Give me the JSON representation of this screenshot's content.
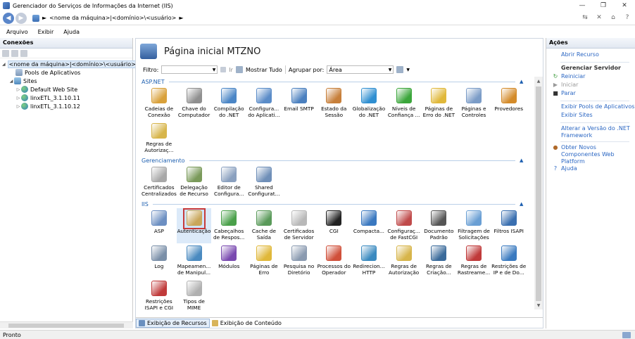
{
  "window": {
    "title": "Gerenciador do Serviços de Informações da Internet (IIS)",
    "controls": [
      "—",
      "❐",
      "✕"
    ]
  },
  "address": {
    "path": "<nome da máquina>|<domínio>\\<usuário>",
    "separator": "►"
  },
  "menu": {
    "items": [
      "Arquivo",
      "Exibir",
      "Ajuda"
    ]
  },
  "connections": {
    "header": "Conexões",
    "tree": [
      {
        "label": "<nome da máquina>|<domínio>\\<usuário>",
        "level": 0,
        "expander": "◢",
        "icon": "server-icon",
        "selected": true
      },
      {
        "label": "Pools de Aplicativos",
        "level": 1,
        "expander": "",
        "icon": "app-pool-icon"
      },
      {
        "label": "Sites",
        "level": 1,
        "expander": "◢",
        "icon": "sites-icon"
      },
      {
        "label": "Default Web Site",
        "level": 2,
        "expander": "▷",
        "icon": "globe-icon"
      },
      {
        "label": "linxETL_3.1.10.11",
        "level": 2,
        "expander": "▷",
        "icon": "globe-icon"
      },
      {
        "label": "linxETL_3.1.10.12",
        "level": 2,
        "expander": "▷",
        "icon": "globe-icon"
      }
    ]
  },
  "home": {
    "title": "Página inicial MTZNO",
    "filter_label": "Filtro:",
    "go_label": "Ir",
    "show_all_label": "Mostrar Tudo",
    "group_label": "Agrupar por:",
    "group_value": "Área"
  },
  "sections": [
    {
      "title": "ASP.NET",
      "items": [
        {
          "label": "Cadeias de Conexão",
          "color": "#d9a13b"
        },
        {
          "label": "Chave do Computador",
          "color": "#8f8f8f"
        },
        {
          "label": "Compilação do .NET",
          "color": "#4b86c6"
        },
        {
          "label": "Configura... do Aplicati...",
          "color": "#5a8cc8"
        },
        {
          "label": "Email SMTP",
          "color": "#4b80bf"
        },
        {
          "label": "Estado da Sessão",
          "color": "#c77f3a"
        },
        {
          "label": "Globalização do .NET",
          "color": "#2f8fd1"
        },
        {
          "label": "Níveis de Confiança ...",
          "color": "#3ba63b"
        },
        {
          "label": "Páginas de Erro do .NET",
          "color": "#e0b83a"
        },
        {
          "label": "Páginas e Controles",
          "color": "#7b9cc7"
        },
        {
          "label": "Provedores",
          "color": "#d48b2a"
        },
        {
          "label": "Regras de Autorizaç...",
          "color": "#d7b54a"
        }
      ]
    },
    {
      "title": "Gerenciamento",
      "items": [
        {
          "label": "Certificados Centralizados",
          "color": "#a8a8a8"
        },
        {
          "label": "Delegação de Recurso",
          "color": "#7a9a5a"
        },
        {
          "label": "Editor de Configura...",
          "color": "#8aa0bf"
        },
        {
          "label": "Shared Configurat...",
          "color": "#6f8fb8"
        }
      ]
    },
    {
      "title": "IIS",
      "items": [
        {
          "label": "ASP",
          "color": "#6c8fc2"
        },
        {
          "label": "Autenticação",
          "color": "#c9a65a",
          "selected": true
        },
        {
          "label": "Cabeçalhos de Respos...",
          "color": "#4aa04a"
        },
        {
          "label": "Cache de Saída",
          "color": "#5a9a5a"
        },
        {
          "label": "Certificados de Servidor",
          "color": "#b8b8b8"
        },
        {
          "label": "CGI",
          "color": "#222222"
        },
        {
          "label": "Compacta...",
          "color": "#3a78c0"
        },
        {
          "label": "Configuraç... de FastCGI",
          "color": "#c04a4a"
        },
        {
          "label": "Documento Padrão",
          "color": "#555555"
        },
        {
          "label": "Filtragem de Solicitações",
          "color": "#6a9fd4"
        },
        {
          "label": "Filtros ISAPI",
          "color": "#3a6fb0"
        },
        {
          "label": "Log",
          "color": "#7a8fa8"
        },
        {
          "label": "Mapeamen... de Manipul...",
          "color": "#4a8ac0"
        },
        {
          "label": "Módulos",
          "color": "#7a4ab0"
        },
        {
          "label": "Páginas de Erro",
          "color": "#e0b83a"
        },
        {
          "label": "Pesquisa no Diretório",
          "color": "#8a9ab0"
        },
        {
          "label": "Processos do Operador",
          "color": "#d0503a"
        },
        {
          "label": "Redirecion... HTTP",
          "color": "#3a8ac0"
        },
        {
          "label": "Regras de Autorização",
          "color": "#d7b54a"
        },
        {
          "label": "Regras de Criação...",
          "color": "#3a6a9a"
        },
        {
          "label": "Regras de Rastreame...",
          "color": "#c03a3a"
        },
        {
          "label": "Restrições de IP e de Do...",
          "color": "#3a7ac0"
        },
        {
          "label": "Restrições ISAPI e CGI",
          "color": "#c03a3a"
        },
        {
          "label": "Tipos de MIME",
          "color": "#b0b0b0"
        }
      ]
    }
  ],
  "view_tabs": [
    {
      "label": "Exibição de Recursos",
      "active": true
    },
    {
      "label": "Exibição de Conteúdo",
      "active": false
    }
  ],
  "actions": {
    "header": "Ações",
    "items": [
      {
        "label": "Abrir Recurso",
        "type": "link",
        "icon": ""
      },
      {
        "label": "Gerenciar Servidor",
        "type": "heading",
        "icon": ""
      },
      {
        "label": "Reiniciar",
        "type": "link",
        "icon": "restart-icon",
        "glyph": "↻",
        "color": "#3a9a3a"
      },
      {
        "label": "Iniciar",
        "type": "disabled",
        "icon": "start-icon",
        "glyph": "▶",
        "color": "#999999"
      },
      {
        "label": "Parar",
        "type": "link",
        "icon": "stop-icon",
        "glyph": "■",
        "color": "#333333"
      },
      {
        "label": "Exibir Pools de Aplicativos",
        "type": "link",
        "icon": ""
      },
      {
        "label": "Exibir Sites",
        "type": "link",
        "icon": ""
      },
      {
        "label": "Alterar a Versão do .NET Framework",
        "type": "link",
        "icon": ""
      },
      {
        "label": "Obter Novos Componentes Web Platform",
        "type": "link",
        "icon": "web-platform-icon",
        "glyph": "●",
        "color": "#b06a2a"
      },
      {
        "label": "Ajuda",
        "type": "link",
        "icon": "help-icon",
        "glyph": "?",
        "color": "#2a66c3"
      }
    ]
  },
  "status": {
    "text": "Pronto"
  }
}
